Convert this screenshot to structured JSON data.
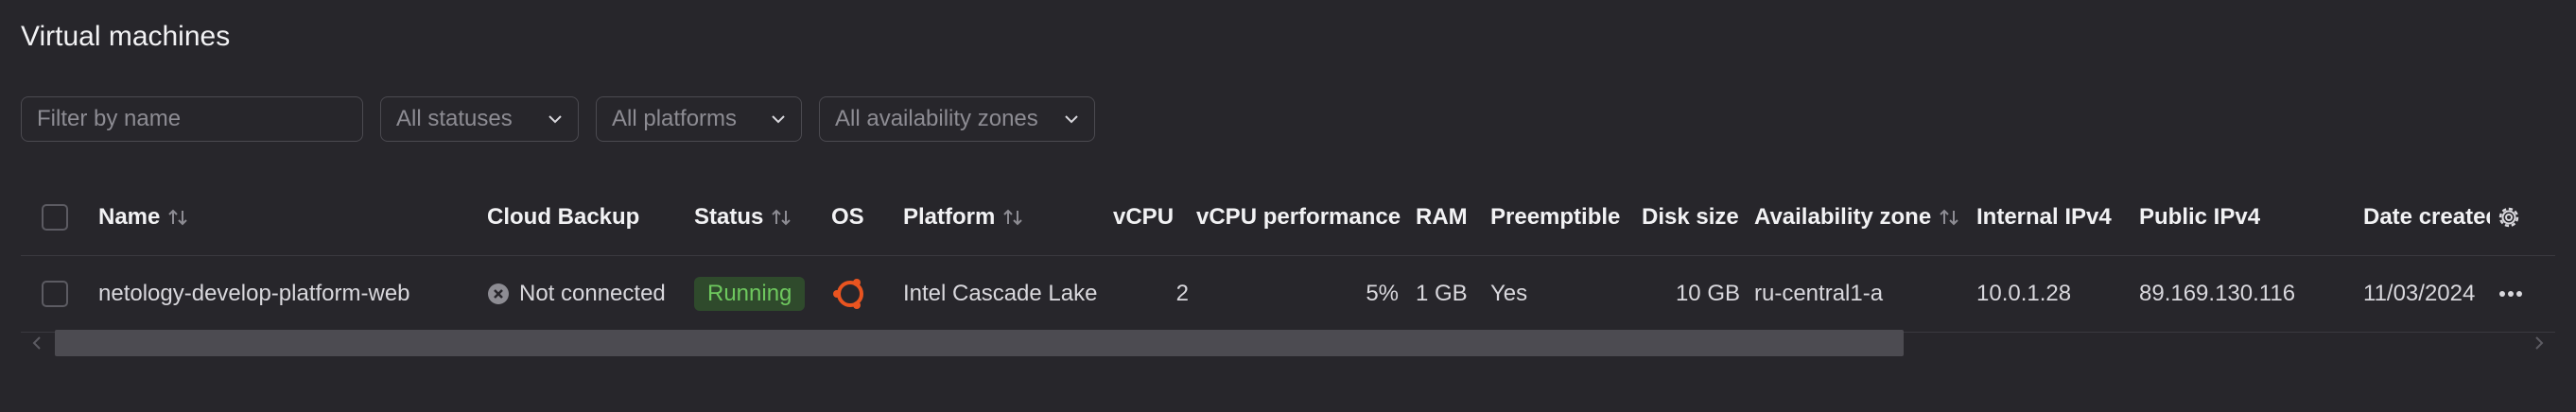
{
  "page": {
    "title": "Virtual machines"
  },
  "filters": {
    "name_placeholder": "Filter by name",
    "status": "All statuses",
    "platform": "All platforms",
    "zone": "All availability zones"
  },
  "table": {
    "columns": {
      "name": "Name",
      "backup": "Cloud Backup",
      "status": "Status",
      "os": "OS",
      "platform": "Platform",
      "vcpu": "vCPU",
      "vcpu_perf": "vCPU performance",
      "ram": "RAM",
      "preemptible": "Preemptible",
      "disk": "Disk size",
      "zone": "Availability zone",
      "internal_ip": "Internal IPv4",
      "public_ip": "Public IPv4",
      "date": "Date created"
    },
    "rows": [
      {
        "name": "netology-develop-platform-web",
        "backup": "Not connected",
        "status": "Running",
        "os": "ubuntu-icon",
        "platform": "Intel Cascade Lake",
        "vcpu": "2",
        "vcpu_perf": "5%",
        "ram": "1 GB",
        "preemptible": "Yes",
        "disk": "10 GB",
        "zone": "ru-central1-a",
        "internal_ip": "10.0.1.28",
        "public_ip": "89.169.130.116",
        "date": "11/03/2024"
      }
    ]
  },
  "colors": {
    "background": "#27262b",
    "running_badge_bg": "#2f4a2c",
    "running_badge_text": "#6ec85e",
    "ubuntu": "#e95420"
  }
}
